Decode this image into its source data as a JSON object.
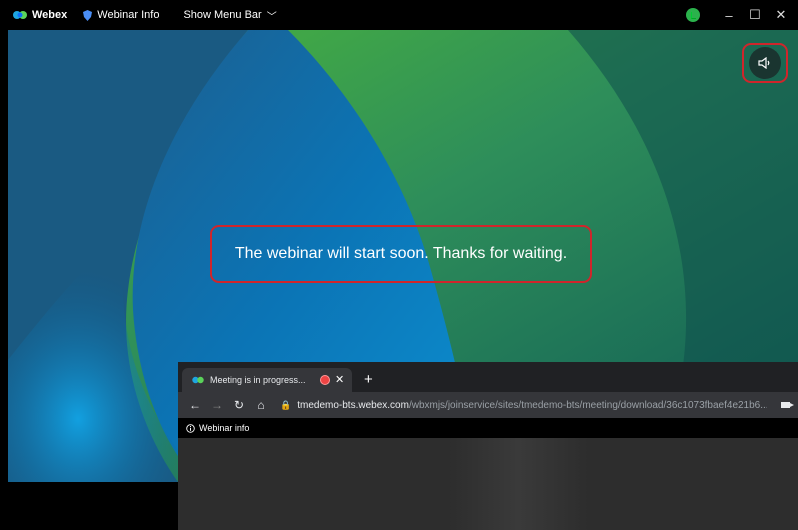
{
  "titlebar": {
    "brand": "Webex",
    "webinar_info": "Webinar Info",
    "show_menu_bar": "Show Menu Bar"
  },
  "window_controls": {
    "minimize": "–",
    "maximize": "☐",
    "close": "✕"
  },
  "stage": {
    "message": "The webinar will start soon. Thanks for waiting."
  },
  "browser": {
    "tab_title": "Meeting is in progress...",
    "url_host": "tmedemo-bts.webex.com",
    "url_path": "/wbxmjs/joinservice/sites/tmedemo-bts/meeting/download/36c1073fbaef4e21b6...",
    "infobar_label": "Webinar info"
  },
  "colors": {
    "highlight_border": "#d0252b",
    "status_green": "#2bb24c"
  }
}
